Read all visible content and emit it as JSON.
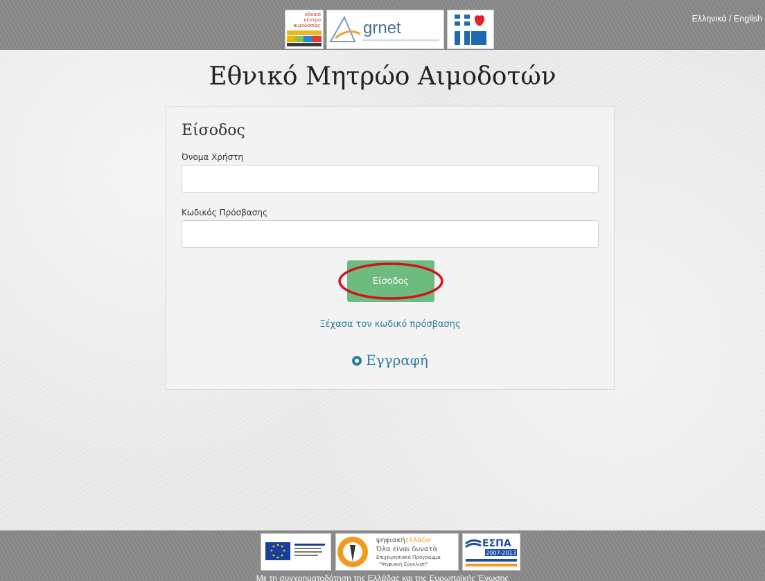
{
  "header": {
    "language_switch": "Ελληνικά / English",
    "logo_ekea": {
      "line1": "εθνικό",
      "line2": "κέντρο",
      "line3": "αιμοδοσίας"
    },
    "logo_grnet": {
      "name": "grnet"
    }
  },
  "page_title": "Εθνικό Μητρώο Αιμοδοτών",
  "login_form": {
    "heading": "Είσοδος",
    "username_label": "Όνομα Χρήστη",
    "username_value": "",
    "password_label": "Κωδικός Πρόσβασης",
    "password_value": "",
    "submit_label": "Είσοδος",
    "forgot_password": "Ξέχασα τον κωδικό πρόσβασης",
    "register": "Εγγραφή"
  },
  "footer": {
    "psif_line1a": "ψηφιακή",
    "psif_line1b": "ελλάδα",
    "psif_line2": "Όλα είναι δυνατά",
    "psif_line3": "Επιχειρησιακό Πρόγραμμα",
    "psif_line4": "\"Ψηφιακή Σύγκλιση\"",
    "espa_title": "ΕΣΠΑ",
    "espa_years": "2007-2013",
    "caption": "Με τη συγχρηματοδότηση της Ελλάδας και της Ευρωπαϊκής Ένωσης"
  },
  "colors": {
    "bar": "#8a8a8a",
    "button": "#6dbb7e",
    "link": "#2a7f98",
    "annotation": "#d0141d"
  }
}
